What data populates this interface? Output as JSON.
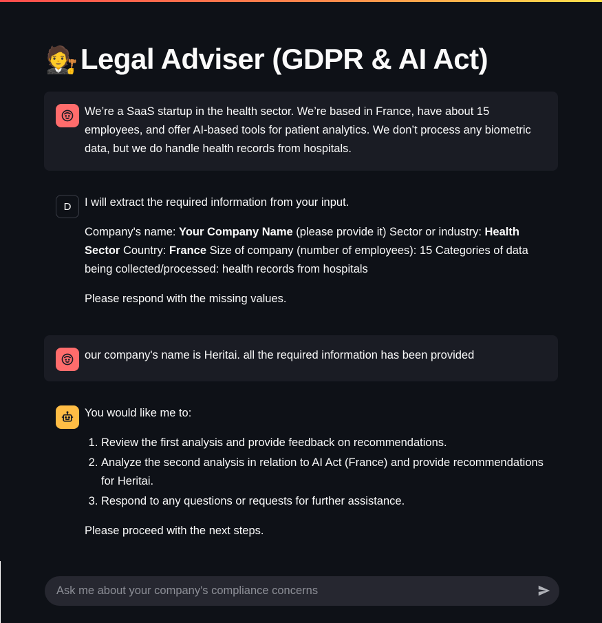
{
  "header": {
    "title_emoji": "🧑‍⚖️",
    "title": "Legal Adviser (GDPR & AI Act)"
  },
  "colors": {
    "user_avatar": "#ff6c6c",
    "assistant_avatar": "#ffbd45",
    "accent_gradient_start": "#ff4b4b",
    "accent_gradient_end": "#ffe14b"
  },
  "messages": [
    {
      "role": "user",
      "avatar_icon": "user-face-icon",
      "text": "We’re a SaaS startup in the health sector. We’re based in France, have about 15 employees, and offer AI-based tools for patient analytics. We don’t process any biometric data, but we do handle health records from hospitals."
    },
    {
      "role": "assistant",
      "avatar_letter": "D",
      "intro": "I will extract the required information from your input.",
      "fields": {
        "name_label": "Company's name: ",
        "name_value": "Your Company Name",
        "name_note": " (please provide it) Sector or industry: ",
        "sector_value": "Health Sector",
        "country_label": " Country: ",
        "country_value": "France",
        "rest": " Size of company (number of employees): 15 Categories of data being collected/processed: health records from hospitals"
      },
      "outro": "Please respond with the missing values."
    },
    {
      "role": "user",
      "avatar_icon": "user-face-icon",
      "text": "our company's name is Heritai. all the required information has been provided"
    },
    {
      "role": "assistant",
      "avatar_icon": "robot-icon",
      "intro": "You would like me to:",
      "steps": [
        "Review the first analysis and provide feedback on recommendations.",
        "Analyze the second analysis in relation to AI Act (France) and provide recommendations for Heritai.",
        "Respond to any questions or requests for further assistance."
      ],
      "outro": "Please proceed with the next steps."
    }
  ],
  "chat_input": {
    "placeholder": "Ask me about your company's compliance concerns",
    "value": "",
    "send_icon": "send-icon"
  }
}
